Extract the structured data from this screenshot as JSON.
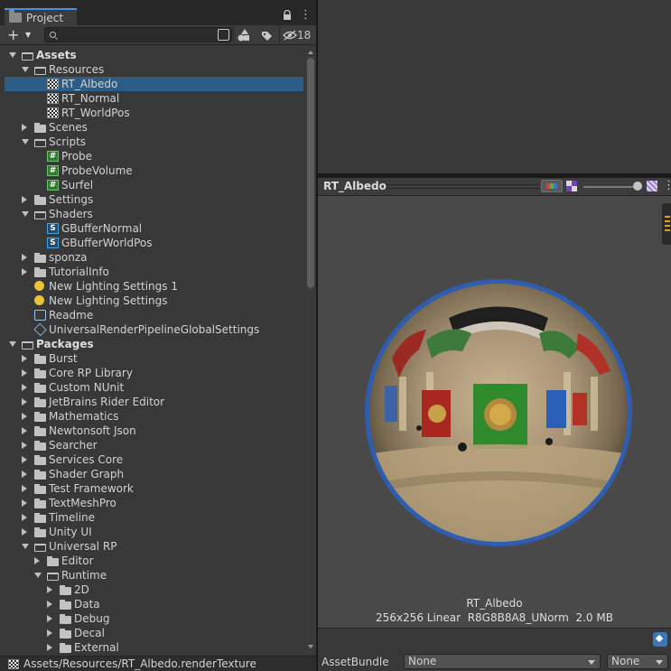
{
  "project": {
    "tab_label": "Project",
    "search_placeholder": "",
    "hidden_packages_count": "18",
    "add_label": "+"
  },
  "tree": [
    {
      "label": "Assets",
      "level": 0,
      "type": "root",
      "expanded": true,
      "bold": true
    },
    {
      "label": "Resources",
      "level": 1,
      "type": "folder",
      "expanded": true
    },
    {
      "label": "RT_Albedo",
      "level": 2,
      "type": "rendertexture",
      "selected": true
    },
    {
      "label": "RT_Normal",
      "level": 2,
      "type": "rendertexture"
    },
    {
      "label": "RT_WorldPos",
      "level": 2,
      "type": "rendertexture"
    },
    {
      "label": "Scenes",
      "level": 1,
      "type": "folder",
      "expanded": false
    },
    {
      "label": "Scripts",
      "level": 1,
      "type": "folder",
      "expanded": true
    },
    {
      "label": "Probe",
      "level": 2,
      "type": "script"
    },
    {
      "label": "ProbeVolume",
      "level": 2,
      "type": "script"
    },
    {
      "label": "Surfel",
      "level": 2,
      "type": "script"
    },
    {
      "label": "Settings",
      "level": 1,
      "type": "folder",
      "expanded": false
    },
    {
      "label": "Shaders",
      "level": 1,
      "type": "folder",
      "expanded": true
    },
    {
      "label": "GBufferNormal",
      "level": 2,
      "type": "shader"
    },
    {
      "label": "GBufferWorldPos",
      "level": 2,
      "type": "shader"
    },
    {
      "label": "sponza",
      "level": 1,
      "type": "folder",
      "expanded": false
    },
    {
      "label": "TutorialInfo",
      "level": 1,
      "type": "folder",
      "expanded": false
    },
    {
      "label": "New Lighting Settings 1",
      "level": 1,
      "type": "lighting"
    },
    {
      "label": "New Lighting Settings",
      "level": 1,
      "type": "lighting"
    },
    {
      "label": "Readme",
      "level": 1,
      "type": "readme"
    },
    {
      "label": "UniversalRenderPipelineGlobalSettings",
      "level": 1,
      "type": "asset"
    },
    {
      "label": "Packages",
      "level": 0,
      "type": "root",
      "expanded": true,
      "bold": true
    },
    {
      "label": "Burst",
      "level": 1,
      "type": "folder",
      "expanded": false
    },
    {
      "label": "Core RP Library",
      "level": 1,
      "type": "folder",
      "expanded": false
    },
    {
      "label": "Custom NUnit",
      "level": 1,
      "type": "folder",
      "expanded": false
    },
    {
      "label": "JetBrains Rider Editor",
      "level": 1,
      "type": "folder",
      "expanded": false
    },
    {
      "label": "Mathematics",
      "level": 1,
      "type": "folder",
      "expanded": false
    },
    {
      "label": "Newtonsoft Json",
      "level": 1,
      "type": "folder",
      "expanded": false
    },
    {
      "label": "Searcher",
      "level": 1,
      "type": "folder",
      "expanded": false
    },
    {
      "label": "Services Core",
      "level": 1,
      "type": "folder",
      "expanded": false
    },
    {
      "label": "Shader Graph",
      "level": 1,
      "type": "folder",
      "expanded": false
    },
    {
      "label": "Test Framework",
      "level": 1,
      "type": "folder",
      "expanded": false
    },
    {
      "label": "TextMeshPro",
      "level": 1,
      "type": "folder",
      "expanded": false
    },
    {
      "label": "Timeline",
      "level": 1,
      "type": "folder",
      "expanded": false
    },
    {
      "label": "Unity UI",
      "level": 1,
      "type": "folder",
      "expanded": false
    },
    {
      "label": "Universal RP",
      "level": 1,
      "type": "folder",
      "expanded": true
    },
    {
      "label": "Editor",
      "level": 2,
      "type": "folder",
      "expanded": false
    },
    {
      "label": "Runtime",
      "level": 2,
      "type": "folder",
      "expanded": true
    },
    {
      "label": "2D",
      "level": 3,
      "type": "folder",
      "expanded": false
    },
    {
      "label": "Data",
      "level": 3,
      "type": "folder",
      "expanded": false
    },
    {
      "label": "Debug",
      "level": 3,
      "type": "folder",
      "expanded": false
    },
    {
      "label": "Decal",
      "level": 3,
      "type": "folder",
      "expanded": false
    },
    {
      "label": "External",
      "level": 3,
      "type": "folder",
      "expanded": false
    }
  ],
  "path_bar": {
    "path": "Assets/Resources/RT_Albedo.renderTexture"
  },
  "preview": {
    "title": "RT_Albedo",
    "name": "RT_Albedo",
    "info": "256x256 Linear  R8G8B8A8_UNorm  2.0 MB"
  },
  "bottom": {
    "asset_bundle_label": "AssetBundle",
    "bundle_value": "None",
    "variant_value": "None"
  },
  "colors": {
    "selection": "#2c5d87",
    "panel_bg": "#383838",
    "preview_bg": "#494949",
    "sphere_rim": "#2f5db0"
  }
}
